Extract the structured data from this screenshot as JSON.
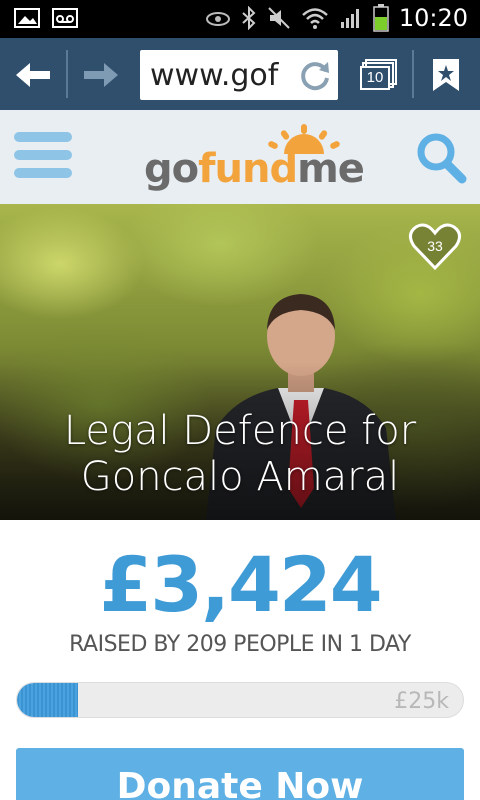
{
  "status_bar": {
    "time": "10:20",
    "icons": [
      "image-icon",
      "voicemail-icon",
      "eye-icon",
      "bluetooth-icon",
      "mute-icon",
      "wifi-icon",
      "signal-icon",
      "battery-icon"
    ]
  },
  "browser": {
    "url": "www.gof",
    "tab_count": "10",
    "icons": [
      "back-arrow-icon",
      "forward-arrow-icon",
      "reload-icon",
      "tabs-icon",
      "bookmark-icon"
    ]
  },
  "site_header": {
    "logo": {
      "go": "go",
      "fund": "fund",
      "me": "me"
    },
    "icons": [
      "hamburger-menu-icon",
      "search-icon"
    ]
  },
  "campaign": {
    "title_line1": "Legal Defence for",
    "title_line2": "Goncalo Amaral",
    "favorite_count": "33",
    "amount_raised": "£3,424",
    "raised_summary": "RAISED BY 209 PEOPLE IN 1 DAY",
    "goal": "£25k",
    "progress_fraction": 0.137,
    "donate_label": "Donate Now"
  },
  "colors": {
    "toolbar": "#2f4f6d",
    "accent_blue": "#3f9bd6",
    "donate_button": "#5fb0e4",
    "logo_orange": "#f3a33c"
  }
}
